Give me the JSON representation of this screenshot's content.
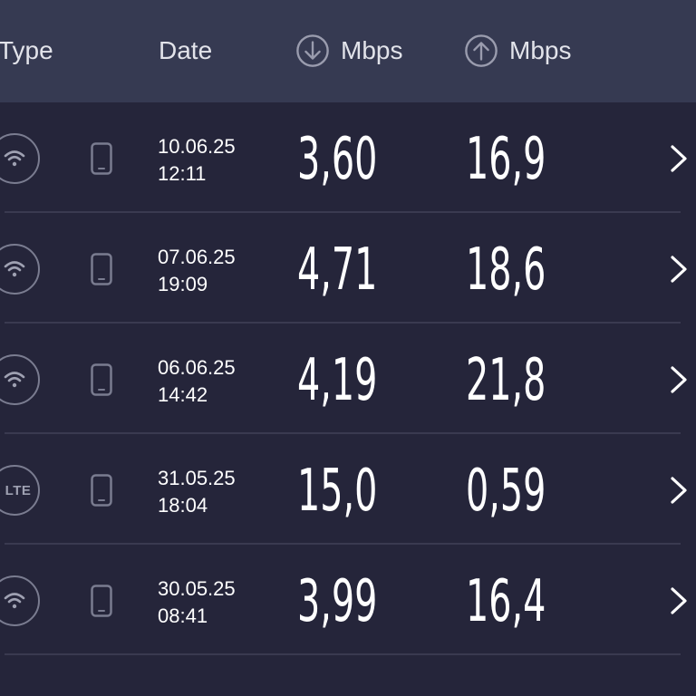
{
  "header": {
    "type_label": "Type",
    "date_label": "Date",
    "download_label": "Mbps",
    "upload_label": "Mbps",
    "download_icon": "arrow-down-circle-icon",
    "upload_icon": "arrow-up-circle-icon"
  },
  "results": [
    {
      "connection": "wifi",
      "device": "phone-icon",
      "date": "10.06.25",
      "time": "12:11",
      "download": "3,60",
      "upload": "16,9"
    },
    {
      "connection": "wifi",
      "device": "phone-icon",
      "date": "07.06.25",
      "time": "19:09",
      "download": "4,71",
      "upload": "18,6"
    },
    {
      "connection": "wifi",
      "device": "phone-icon",
      "date": "06.06.25",
      "time": "14:42",
      "download": "4,19",
      "upload": "21,8"
    },
    {
      "connection": "LTE",
      "device": "phone-icon",
      "date": "31.05.25",
      "time": "18:04",
      "download": "15,0",
      "upload": "0,59"
    },
    {
      "connection": "wifi",
      "device": "phone-icon",
      "date": "30.05.25",
      "time": "08:41",
      "download": "3,99",
      "upload": "16,4"
    }
  ],
  "colors": {
    "background": "#25253a",
    "header": "#363a52",
    "icon_gray": "#7a7c90",
    "text": "#ffffff"
  }
}
